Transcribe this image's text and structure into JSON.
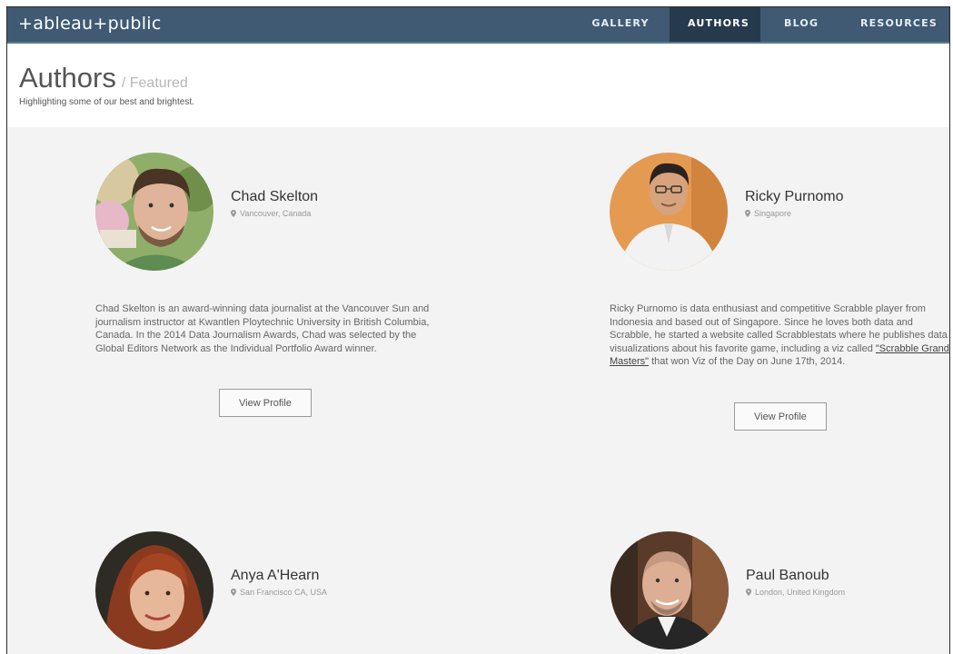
{
  "app": {
    "logo_prefix": "+",
    "logo_word1": "ableau",
    "logo_mark": "+",
    "logo_word2": "public"
  },
  "nav": {
    "items": [
      {
        "label": "GALLERY",
        "active": false
      },
      {
        "label": "AUTHORS",
        "active": true
      },
      {
        "label": "BLOG",
        "active": false
      },
      {
        "label": "RESOURCES",
        "active": false
      }
    ]
  },
  "header": {
    "title": "Authors",
    "separator": "/",
    "subtitle": "Featured",
    "tagline": "Highlighting some of our best and brightest."
  },
  "authors": [
    {
      "name": "Chad Skelton",
      "location": "Vancouver, Canada",
      "bio": "Chad Skelton is an award-winning data journalist at the Vancouver Sun and journalism instructor at Kwantlen Ploytechnic University in British Columbia, Canada. In the 2014 Data Journalism Awards, Chad was selected by the Global Editors Network as the Individual Portfolio Award winner.",
      "button": "View Profile"
    },
    {
      "name": "Ricky Purnomo",
      "location": "Singapore",
      "bio_before": "Ricky Purnomo is data enthusiast and competitive Scrabble player from Indonesia and based out of Singapore. Since he loves both data and Scrabble, he started a website called Scrabblestats where he publishes data visualizations about his favorite game, including a viz called ",
      "bio_link": "\"Scrabble Grand Masters\"",
      "bio_after": " that won Viz of the Day on June 17th, 2014.",
      "button": "View Profile"
    },
    {
      "name": "Anya A'Hearn",
      "location": "San Francisco CA, USA"
    },
    {
      "name": "Paul Banoub",
      "location": "London, United Kingdom"
    }
  ],
  "icons": {
    "location": "map-pin-icon"
  }
}
